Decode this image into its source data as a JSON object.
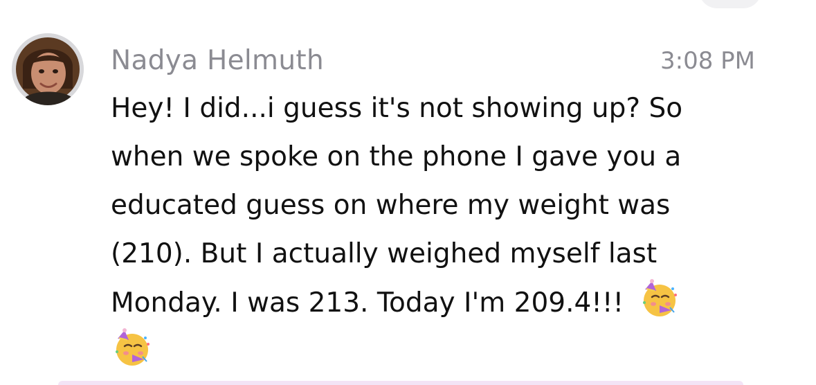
{
  "message": {
    "sender_name": "Nadya Helmuth",
    "timestamp": "3:08 PM",
    "lines": [
      "Hey! I did...i guess it's not showing up? So",
      "when we spoke on the phone I gave you a",
      "educated guess on where my weight was",
      "(210). But I actually weighed myself last",
      "Monday. I was 213. Today I'm 209.4!!!"
    ],
    "emojis": [
      "partying-face-icon",
      "partying-face-icon"
    ]
  },
  "colors": {
    "meta_text": "#8b8b92",
    "body_text": "#111111",
    "avatar_ring": "#d9d9dc",
    "bottom_bar": "#f3e4f6"
  }
}
